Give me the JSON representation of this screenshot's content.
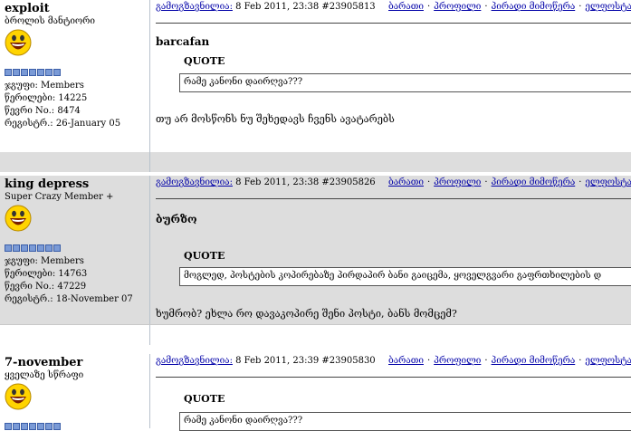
{
  "posts": [
    {
      "username": "exploit",
      "user_title": "ბროლის მანტიორი",
      "group_label": "ჯგუფი:",
      "group": "Members",
      "posts_label": "წერილები:",
      "posts": "14225",
      "num_label": "წევრი No.:",
      "num": "8474",
      "reg_label": "რეგისტრ.:",
      "reg": "26-January 05",
      "header_label": "გამოგზავნილია:",
      "date": "8 Feb 2011, 23:38",
      "post_id": "#23905813",
      "links": [
        "ბარათი",
        "პროფილი",
        "პირადი მიმოწერა",
        "ელფოსტა"
      ],
      "title": "barcafan",
      "quote_label": "QUOTE",
      "quote_text": "რამე კანონი დაირღვა???",
      "body": "თუ არ მოსწონს ნუ შეხედავს ჩვენს ავატარებს"
    },
    {
      "username": "king depress",
      "user_title": "Super Crazy Member +",
      "group_label": "ჯგუფი:",
      "group": "Members",
      "posts_label": "წერილები:",
      "posts": "14763",
      "num_label": "წევრი No.:",
      "num": "47229",
      "reg_label": "რეგისტრ.:",
      "reg": "18-November 07",
      "header_label": "გამოგზავნილია:",
      "date": "8 Feb 2011, 23:38",
      "post_id": "#23905826",
      "links": [
        "ბარათი",
        "პროფილი",
        "პირადი მიმოწერა",
        "ელფოსტა"
      ],
      "title": "ბურზო",
      "quote_label": "QUOTE",
      "quote_text": "მოგლედ, პოსტების კოპირებაზე პირდაპირ ბანი გაიცემა, ყოველგვარი გაფრთხილების დ",
      "body": "ხუმრობ? ეხლა რო დავაკოპირე შენი პოსტი, ბანს მომცემ?"
    },
    {
      "username": "7-november",
      "user_title": "ყველაზე სწრაფი",
      "header_label": "გამოგზავნილია:",
      "date": "8 Feb 2011, 23:39",
      "post_id": "#23905830",
      "links": [
        "ბარათი",
        "პროფილი",
        "პირადი მიმოწერა",
        "ელფოსტა"
      ],
      "quote_label": "QUOTE",
      "quote_text": "რამე კანონი დაირღვა???"
    }
  ],
  "colors": {
    "post_bg_white": "#ffffff",
    "post_bg_grey": "#dddddd",
    "link": "#0000a8",
    "pip": "#7a9ad6"
  },
  "icons": {
    "avatar": "smiley-face-icon",
    "rank": "rank-pip-icon"
  }
}
